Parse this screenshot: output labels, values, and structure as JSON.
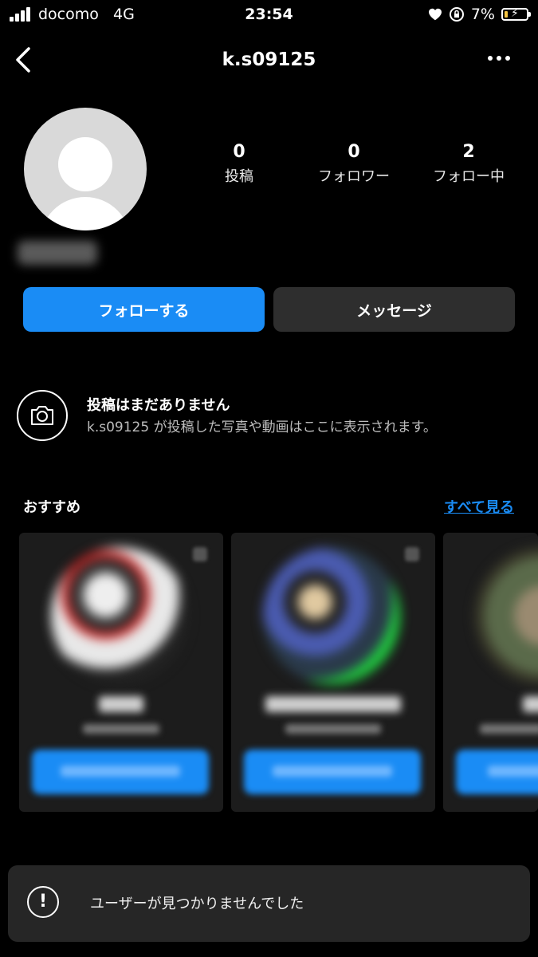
{
  "status_bar": {
    "carrier": "docomo",
    "network": "4G",
    "time": "23:54",
    "battery_percent": "7%",
    "battery_level": 0.07,
    "icons": [
      "signal-icon",
      "heart-icon",
      "rotation-lock-icon",
      "battery-charging-icon"
    ]
  },
  "header": {
    "title": "k.s09125",
    "icons": [
      "back-chevron-icon",
      "more-dots-icon"
    ]
  },
  "profile": {
    "stats": [
      {
        "value": "0",
        "label": "投稿"
      },
      {
        "value": "0",
        "label": "フォロワー"
      },
      {
        "value": "2",
        "label": "フォロー中"
      }
    ]
  },
  "actions": {
    "follow_label": "フォローする",
    "message_label": "メッセージ"
  },
  "empty_posts": {
    "title": "投稿はまだありません",
    "subtitle": "k.s09125 が投稿した写真や動画はここに表示されます。",
    "icon": "camera-icon"
  },
  "suggestions": {
    "title": "おすすめ",
    "see_all": "すべて見る"
  },
  "toast": {
    "message": "ユーザーが見つかりませんでした",
    "icon": "exclamation-circle-icon"
  },
  "colors": {
    "accent": "#1a8cf5",
    "background": "#000000",
    "secondary_button": "#2e2e2e",
    "toast_background": "#262626"
  }
}
